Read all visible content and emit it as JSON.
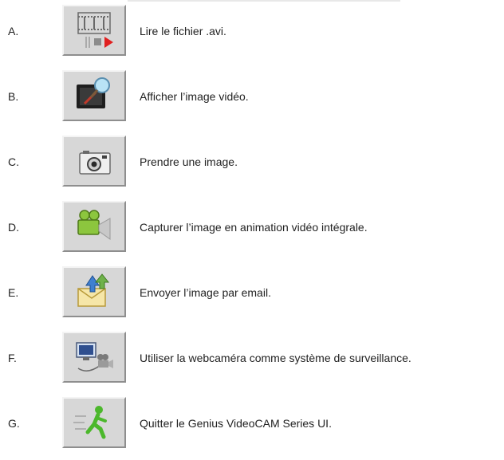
{
  "items": [
    {
      "letter": "A.",
      "icon": "play-avi-icon",
      "description": "Lire le fichier .avi."
    },
    {
      "letter": "B.",
      "icon": "video-preview-icon",
      "description": "Afficher l’image vidéo."
    },
    {
      "letter": "C.",
      "icon": "camera-icon",
      "description": "Prendre une image."
    },
    {
      "letter": "D.",
      "icon": "video-camera-icon",
      "description": "Capturer l’image en animation vidéo intégrale."
    },
    {
      "letter": "E.",
      "icon": "email-icon",
      "description": "Envoyer l’image par email."
    },
    {
      "letter": "F.",
      "icon": "surveillance-icon",
      "description": "Utiliser la webcaméra comme système de surveillance."
    },
    {
      "letter": "G.",
      "icon": "exit-icon",
      "description": "Quitter le Genius VideoCAM Series UI."
    }
  ]
}
